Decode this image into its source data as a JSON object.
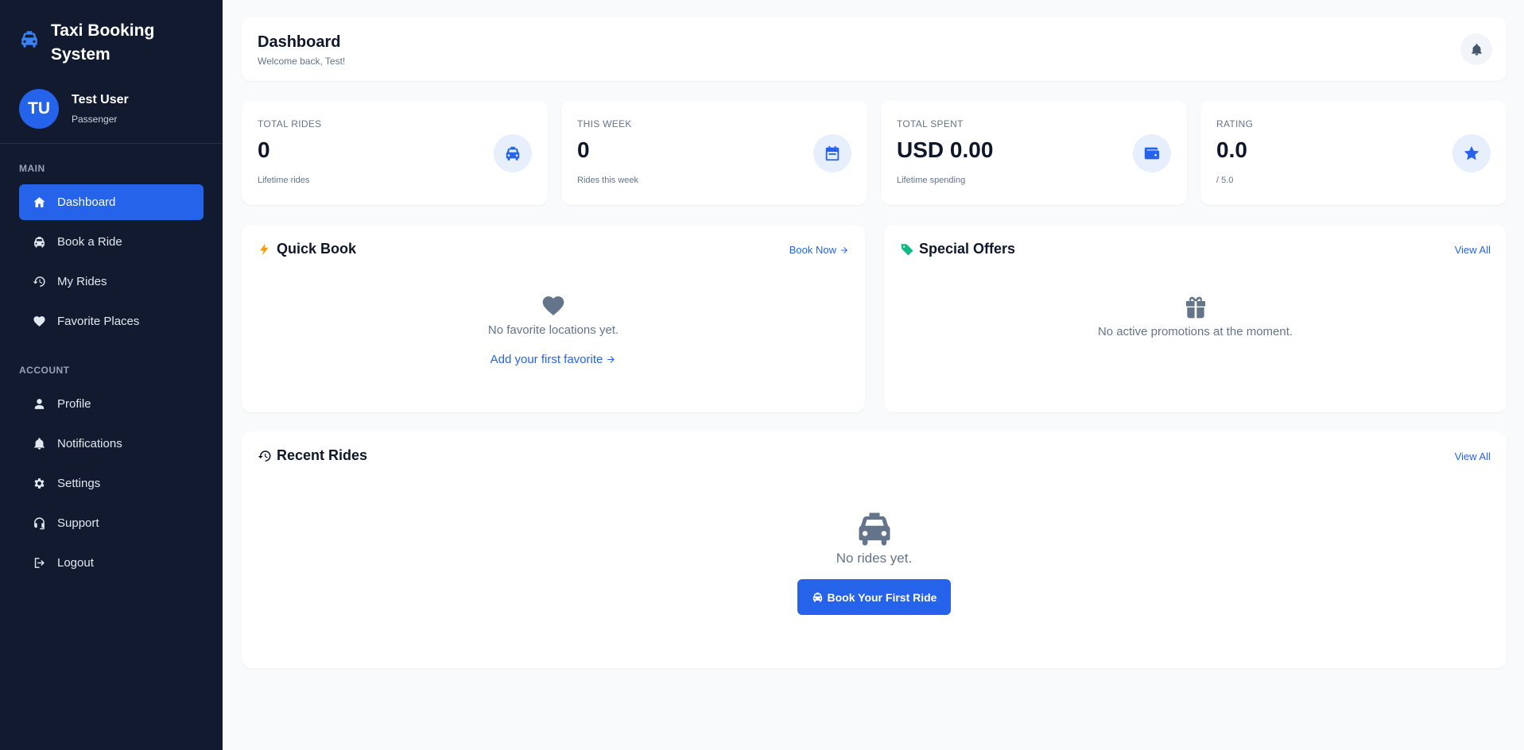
{
  "app": {
    "title": "Taxi Booking System",
    "brand_icon": "taxi-icon"
  },
  "user": {
    "initials": "TU",
    "name": "Test User",
    "role": "Passenger"
  },
  "sidebar": {
    "main_label": "MAIN",
    "account_label": "ACCOUNT",
    "main_items": [
      {
        "label": "Dashboard",
        "icon": "home-icon",
        "active": true
      },
      {
        "label": "Book a Ride",
        "icon": "car-icon"
      },
      {
        "label": "My Rides",
        "icon": "history-icon"
      },
      {
        "label": "Favorite Places",
        "icon": "heart-icon"
      }
    ],
    "account_items": [
      {
        "label": "Profile",
        "icon": "user-icon"
      },
      {
        "label": "Notifications",
        "icon": "bell-icon"
      },
      {
        "label": "Settings",
        "icon": "gear-icon"
      },
      {
        "label": "Support",
        "icon": "headset-icon"
      },
      {
        "label": "Logout",
        "icon": "logout-icon"
      }
    ]
  },
  "header": {
    "title": "Dashboard",
    "subtitle": "Welcome back, Test!"
  },
  "stats": [
    {
      "label": "TOTAL RIDES",
      "value": "0",
      "sub": "Lifetime rides",
      "icon": "taxi-icon"
    },
    {
      "label": "THIS WEEK",
      "value": "0",
      "sub": "Rides this week",
      "icon": "calendar-icon"
    },
    {
      "label": "TOTAL SPENT",
      "value": "USD 0.00",
      "sub": "Lifetime spending",
      "icon": "wallet-icon"
    },
    {
      "label": "RATING",
      "value": "0.0",
      "sub": "/ 5.0",
      "icon": "star-icon"
    }
  ],
  "quick_book": {
    "title": "Quick Book",
    "link": "Book Now",
    "empty_text": "No favorite locations yet.",
    "empty_link": "Add your first favorite"
  },
  "offers": {
    "title": "Special Offers",
    "link": "View All",
    "empty_text": "No active promotions at the moment."
  },
  "recent": {
    "title": "Recent Rides",
    "link": "View All",
    "empty_text": "No rides yet.",
    "button": "Book Your First Ride"
  },
  "colors": {
    "sidebar_bg": "#111a2e",
    "accent": "#2563eb",
    "bolt": "#f59e0b",
    "tag": "#10b981",
    "muted_icon": "#64748b"
  }
}
